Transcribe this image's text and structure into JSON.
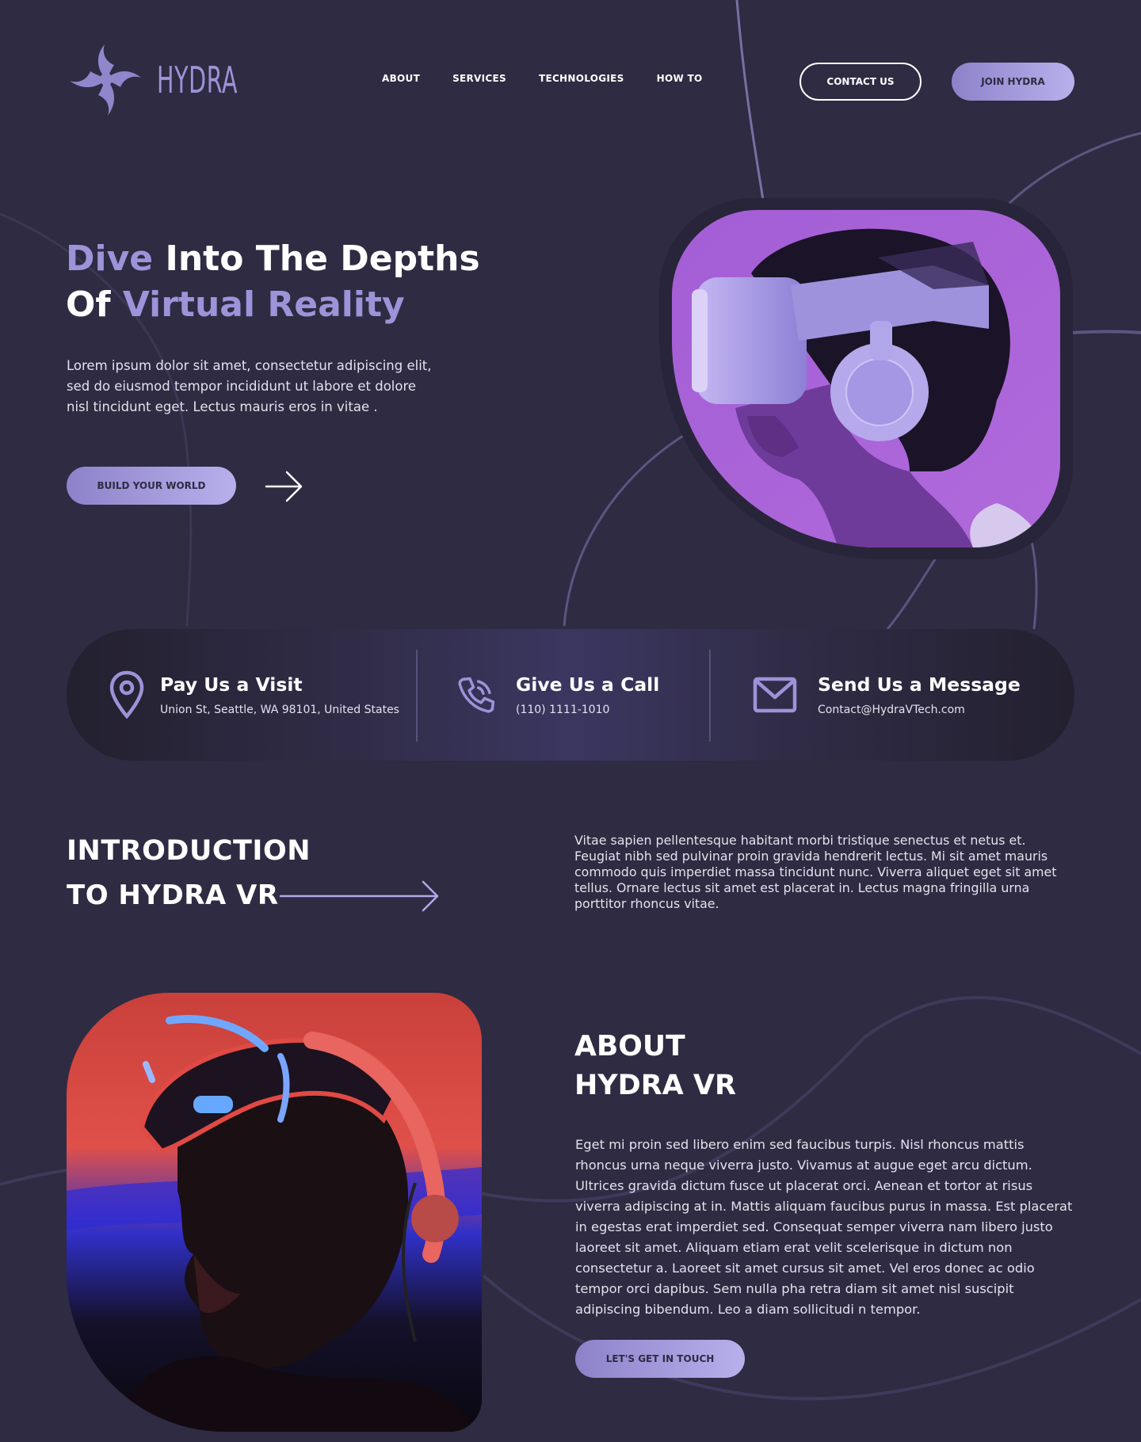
{
  "brand": {
    "name": "HYDRA",
    "accent": "#9d93d8",
    "background": "#2e2b42"
  },
  "nav": {
    "items": [
      "ABOUT",
      "SERVICES",
      "TECHNOLOGIES",
      "HOW TO"
    ]
  },
  "header": {
    "contact_label": "CONTACT US",
    "join_label": "JOIN HYDRA"
  },
  "hero": {
    "title_w1": "Dive",
    "title_w2": " Into The Depths",
    "title_w3": "Of ",
    "title_w4": "Virtual Reality",
    "text": "Lorem ipsum dolor sit amet, consectetur adipiscing elit, sed do eiusmod tempor incididunt ut labore et dolore nisl tincidunt eget. Lectus mauris eros in vitae .",
    "cta_label": "BUILD YOUR WORLD"
  },
  "contact": {
    "visit": {
      "title": "Pay Us a Visit",
      "detail": "Union St, Seattle, WA 98101, United States"
    },
    "call": {
      "title": "Give Us a Call",
      "detail": "(110) 1111-1010"
    },
    "message": {
      "title": "Send Us a Message",
      "detail": "Contact@HydraVTech.com"
    }
  },
  "intro": {
    "heading": "INTRODUCTION",
    "subheading": "TO HYDRA VR",
    "text": "Vitae sapien pellentesque habitant morbi tristique senectus et netus et. Feugiat nibh sed pulvinar proin gravida hendrerit lectus. Mi sit amet mauris commodo quis imperdiet massa tincidunt nunc. Viverra aliquet eget sit amet tellus. Ornare lectus sit amet est placerat in. Lectus magna fringilla urna porttitor rhoncus vitae."
  },
  "about": {
    "heading": "ABOUT",
    "subheading": "HYDRA VR",
    "text": "Eget mi proin sed libero enim sed faucibus turpis. Nisl rhoncus mattis rhoncus urna neque viverra justo. Vivamus at augue eget arcu dictum. Ultrices gravida dictum fusce ut placerat orci. Aenean et tortor at risus viverra adipiscing at in. Mattis aliquam faucibus purus in massa. Est placerat in egestas erat imperdiet sed. Consequat semper viverra nam libero justo laoreet sit amet. Aliquam etiam erat velit scelerisque in dictum non consectetur a. Laoreet sit amet cursus sit amet. Vel eros donec ac odio tempor orci dapibus. Sem nulla pha retra diam sit amet nisl suscipit adipiscing bibendum. Leo a diam sollicitudi n tempor.",
    "cta_label": "LET'S GET IN TOUCH"
  }
}
